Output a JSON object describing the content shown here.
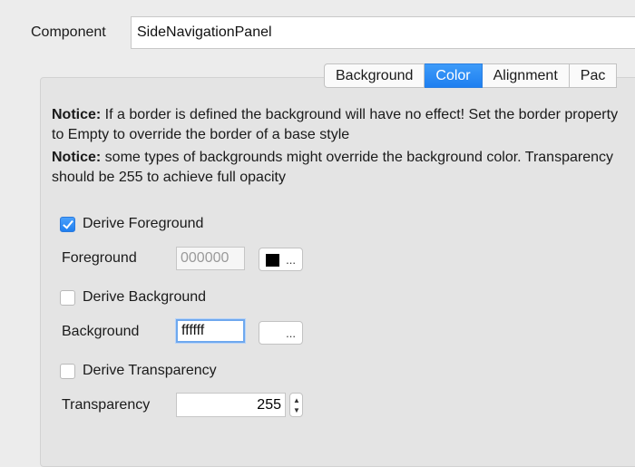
{
  "component": {
    "label": "Component",
    "value": "SideNavigationPanel"
  },
  "tabs": [
    {
      "label": "Background",
      "active": false
    },
    {
      "label": "Color",
      "active": true
    },
    {
      "label": "Alignment",
      "active": false
    },
    {
      "label": "Pac",
      "active": false
    }
  ],
  "notices": [
    {
      "bold": "Notice:",
      "text": " If a border is defined the background will have no effect! Set the border property to Empty to override the border of a base style"
    },
    {
      "bold": "Notice:",
      "text": " some types of backgrounds might override the background color. Transparency should be 255 to achieve full opacity"
    }
  ],
  "foreground": {
    "derive_label": "Derive Foreground",
    "derive_checked": true,
    "label": "Foreground",
    "value": "000000",
    "color": "#000000",
    "button_label": "..."
  },
  "background": {
    "derive_label": "Derive Background",
    "derive_checked": false,
    "label": "Background",
    "value": "ffffff",
    "button_label": "..."
  },
  "transparency": {
    "derive_label": "Derive Transparency",
    "derive_checked": false,
    "label": "Transparency",
    "value": "255"
  },
  "colors": {
    "accent": "#1e7ff0",
    "panel_bg": "#e4e4e4",
    "window_bg": "#ececec"
  }
}
